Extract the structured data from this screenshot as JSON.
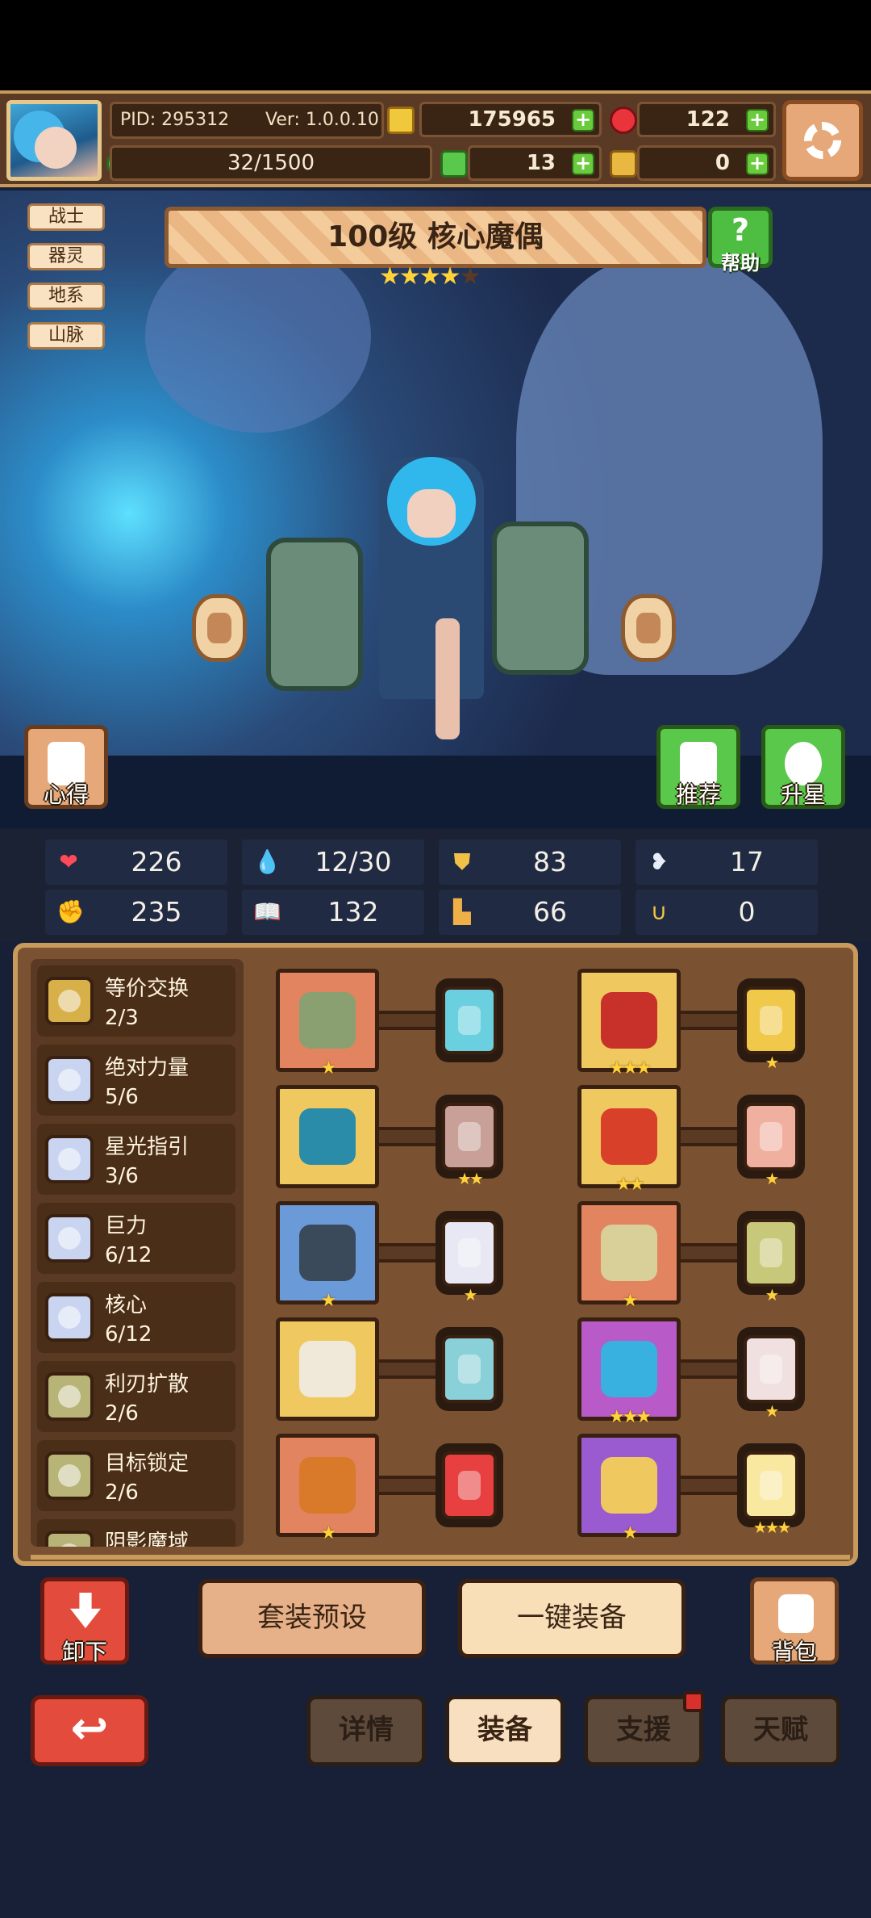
{
  "header": {
    "pid": "PID: 295312",
    "version": "Ver: 1.0.0.10",
    "gold": "175965",
    "ruby": "122",
    "energy": "32/1500",
    "clover": "13",
    "feather": "0",
    "plus": "+"
  },
  "hero": {
    "tags": [
      "战士",
      "器灵",
      "地系",
      "山脉"
    ],
    "title": "100级 核心魔偶",
    "stars_filled": 4,
    "stars_total": 5,
    "help_label": "帮助",
    "help_symbol": "?",
    "insight_label": "心得",
    "recommend_label": "推荐",
    "upstar_label": "升星"
  },
  "stats": [
    {
      "icon": "heart-icon",
      "glyph": "❤",
      "value": "226"
    },
    {
      "icon": "water-drop-icon",
      "glyph": "💧",
      "value": "12/30"
    },
    {
      "icon": "shield-icon",
      "glyph": "⛊",
      "value": "83"
    },
    {
      "icon": "wing-icon",
      "glyph": "❥",
      "value": "17"
    },
    {
      "icon": "fist-icon",
      "glyph": "✊",
      "value": "235"
    },
    {
      "icon": "book-icon",
      "glyph": "📖",
      "value": "132"
    },
    {
      "icon": "boot-icon",
      "glyph": "▙",
      "value": "66"
    },
    {
      "icon": "horseshoe-icon",
      "glyph": "∪",
      "value": "0"
    }
  ],
  "sets": [
    {
      "name": "等价交换",
      "progress": "2/3",
      "color": "#d8b04a"
    },
    {
      "name": "绝对力量",
      "progress": "5/6",
      "color": "#c8d4f0"
    },
    {
      "name": "星光指引",
      "progress": "3/6",
      "color": "#c8d4f0"
    },
    {
      "name": "巨力",
      "progress": "6/12",
      "color": "#c8d4f0"
    },
    {
      "name": "核心",
      "progress": "6/12",
      "color": "#c8d4f0"
    },
    {
      "name": "利刃扩散",
      "progress": "2/6",
      "color": "#b8b478"
    },
    {
      "name": "目标锁定",
      "progress": "2/6",
      "color": "#b8b478"
    },
    {
      "name": "阴影魔域",
      "progress": "",
      "color": "#b8b478"
    }
  ],
  "equipment": [
    {
      "slot": "sword",
      "bg": "#e38460",
      "item": "#8aa070",
      "stars": 1,
      "gem": "#6ad0e0",
      "gem_stars": 0
    },
    {
      "slot": "chest-armor",
      "bg": "#f0c860",
      "item": "#c8302a",
      "stars": 3,
      "gem": "#f0c84a",
      "gem_stars": 1
    },
    {
      "slot": "shield",
      "bg": "#f0c860",
      "item": "#2a8ca8",
      "stars": 0,
      "gem": "#c8a098",
      "gem_stars": 2
    },
    {
      "slot": "cape",
      "bg": "#f0c860",
      "item": "#d8402a",
      "stars": 2,
      "gem": "#f0b0a0",
      "gem_stars": 1
    },
    {
      "slot": "necklace",
      "bg": "#6a9ad8",
      "item": "#3a4a5a",
      "stars": 1,
      "gem": "#e8e8f4",
      "gem_stars": 1
    },
    {
      "slot": "feather",
      "bg": "#e38460",
      "item": "#d8d098",
      "stars": 1,
      "gem": "#c8c87a",
      "gem_stars": 1
    },
    {
      "slot": "helmet",
      "bg": "#f0c860",
      "item": "#f0e8d8",
      "stars": 0,
      "gem": "#8ad0d8",
      "gem_stars": 0
    },
    {
      "slot": "ring",
      "bg": "#b85ac8",
      "item": "#38b0e0",
      "stars": 3,
      "gem": "#f0e0e0",
      "gem_stars": 1
    },
    {
      "slot": "belt",
      "bg": "#e38460",
      "item": "#d87a2a",
      "stars": 1,
      "gem": "#e84040",
      "gem_stars": 0
    },
    {
      "slot": "boots",
      "bg": "#9a5ad0",
      "item": "#f0c860",
      "stars": 1,
      "gem": "#f8e8a0",
      "gem_stars": 3
    }
  ],
  "actions": {
    "unload_label": "卸下",
    "preset_label": "套装预设",
    "equip_all_label": "一键装备",
    "bag_label": "背包"
  },
  "nav": {
    "back_symbol": "↩",
    "tabs": [
      "详情",
      "装备",
      "支援",
      "天赋"
    ],
    "active": "装备"
  }
}
